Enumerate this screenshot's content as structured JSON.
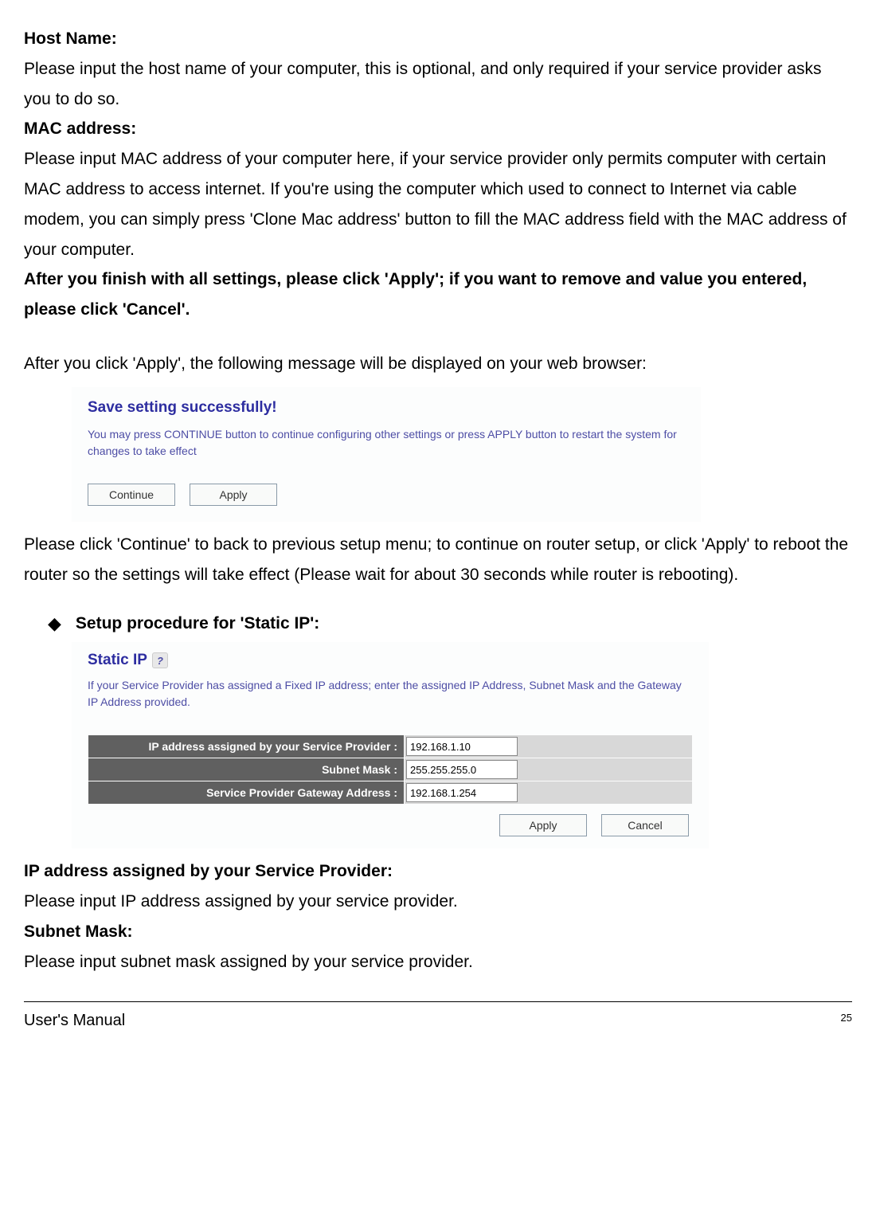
{
  "section_hostname": {
    "heading": "Host Name:",
    "body": "Please input the host name of your computer, this is optional, and only required if your service provider asks you to do so."
  },
  "section_mac": {
    "heading": "MAC address:",
    "body": "Please input MAC address of your computer here, if your service provider only permits computer with certain MAC address to access internet. If you're using the computer which used to connect to Internet via cable modem, you can simply press 'Clone Mac address' button to fill the MAC address field with the MAC address of your computer."
  },
  "apply_note": "After you finish with all settings, please click 'Apply'; if you want to remove and value you entered, please click 'Cancel'.",
  "after_apply": "After you click 'Apply', the following message will be displayed on your web browser:",
  "save_box": {
    "title": "Save setting successfully!",
    "text": "You may press CONTINUE button to continue configuring other settings or press APPLY button to restart the system for changes to take effect",
    "continue_label": "Continue",
    "apply_label": "Apply"
  },
  "continue_note": "Please click 'Continue' to back to previous setup menu; to continue on router setup, or click 'Apply' to reboot the router so the settings will take effect (Please wait for about 30 seconds while router is rebooting).",
  "bullet": {
    "title": "Setup procedure for 'Static IP':"
  },
  "static_ip_box": {
    "title": "Static IP",
    "help": "?",
    "desc": "If your Service Provider has assigned a Fixed IP address; enter the assigned IP Address, Subnet Mask and the Gateway IP Address provided.",
    "rows": [
      {
        "label": "IP address assigned by your Service Provider :",
        "value": "192.168.1.10"
      },
      {
        "label": "Subnet Mask :",
        "value": "255.255.255.0"
      },
      {
        "label": "Service Provider Gateway Address :",
        "value": "192.168.1.254"
      }
    ],
    "apply_label": "Apply",
    "cancel_label": "Cancel"
  },
  "section_ip": {
    "heading": "IP address assigned by your Service Provider:",
    "body": "Please input IP address assigned by your service provider."
  },
  "section_subnet": {
    "heading": "Subnet Mask:",
    "body": "Please input subnet mask assigned by your service provider."
  },
  "footer": {
    "manual": "User's Manual",
    "page": "25"
  }
}
